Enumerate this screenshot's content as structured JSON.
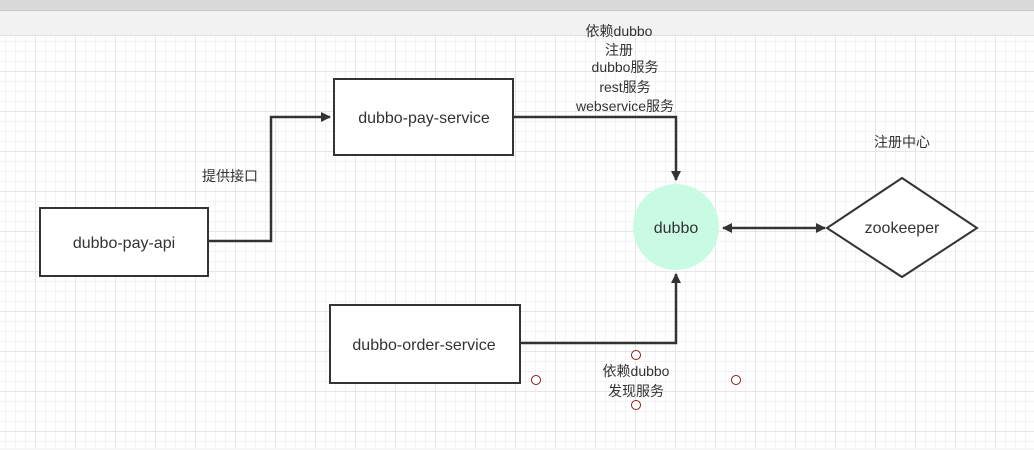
{
  "nodes": {
    "pay_api": {
      "label": "dubbo-pay-api"
    },
    "pay_service": {
      "label": "dubbo-pay-service"
    },
    "order_service": {
      "label": "dubbo-order-service"
    },
    "dubbo": {
      "label": "dubbo",
      "color": "#c9fbe4"
    },
    "zookeeper": {
      "label": "zookeeper"
    }
  },
  "labels": {
    "provide_interface": "提供接口",
    "registry_center": "注册中心",
    "register_lines": [
      "依赖dubbo",
      "注册",
      "dubbo服务",
      "rest服务",
      "webservice服务"
    ],
    "discover_lines": [
      "依赖dubbo",
      "发现服务"
    ]
  },
  "colors": {
    "stroke": "#333333",
    "handle": "#8b1a1a"
  }
}
